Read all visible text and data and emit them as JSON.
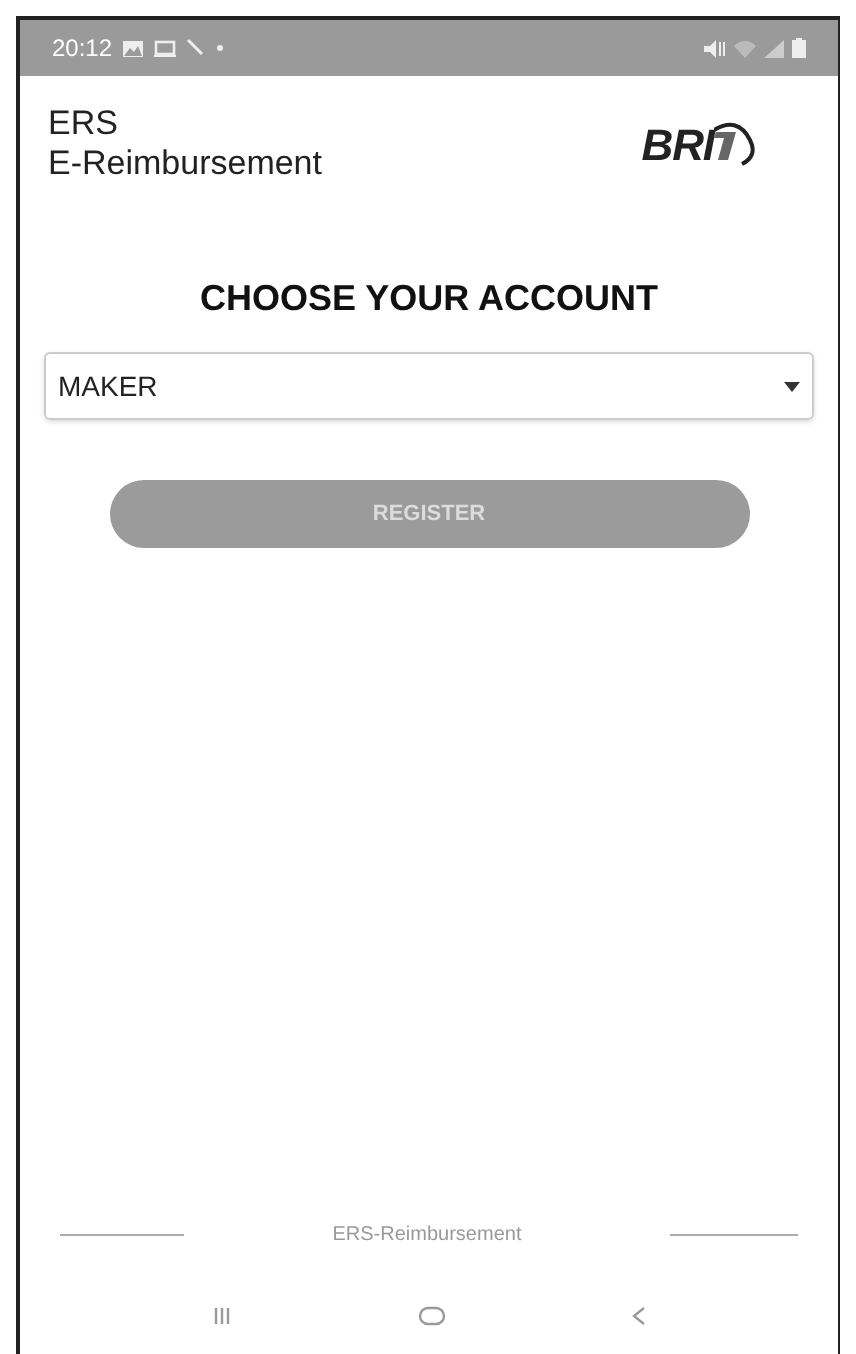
{
  "status_bar": {
    "time": "20:12"
  },
  "header": {
    "title_lines": [
      "ERS",
      "E-Reimbursement"
    ],
    "logo_text": "BRI"
  },
  "heading": "CHOOSE YOUR ACCOUNT",
  "account_select": {
    "value": "MAKER"
  },
  "register_button": {
    "label": "REGISTER",
    "disabled": true
  },
  "footer": {
    "text": "ERS-Reimbursement"
  }
}
